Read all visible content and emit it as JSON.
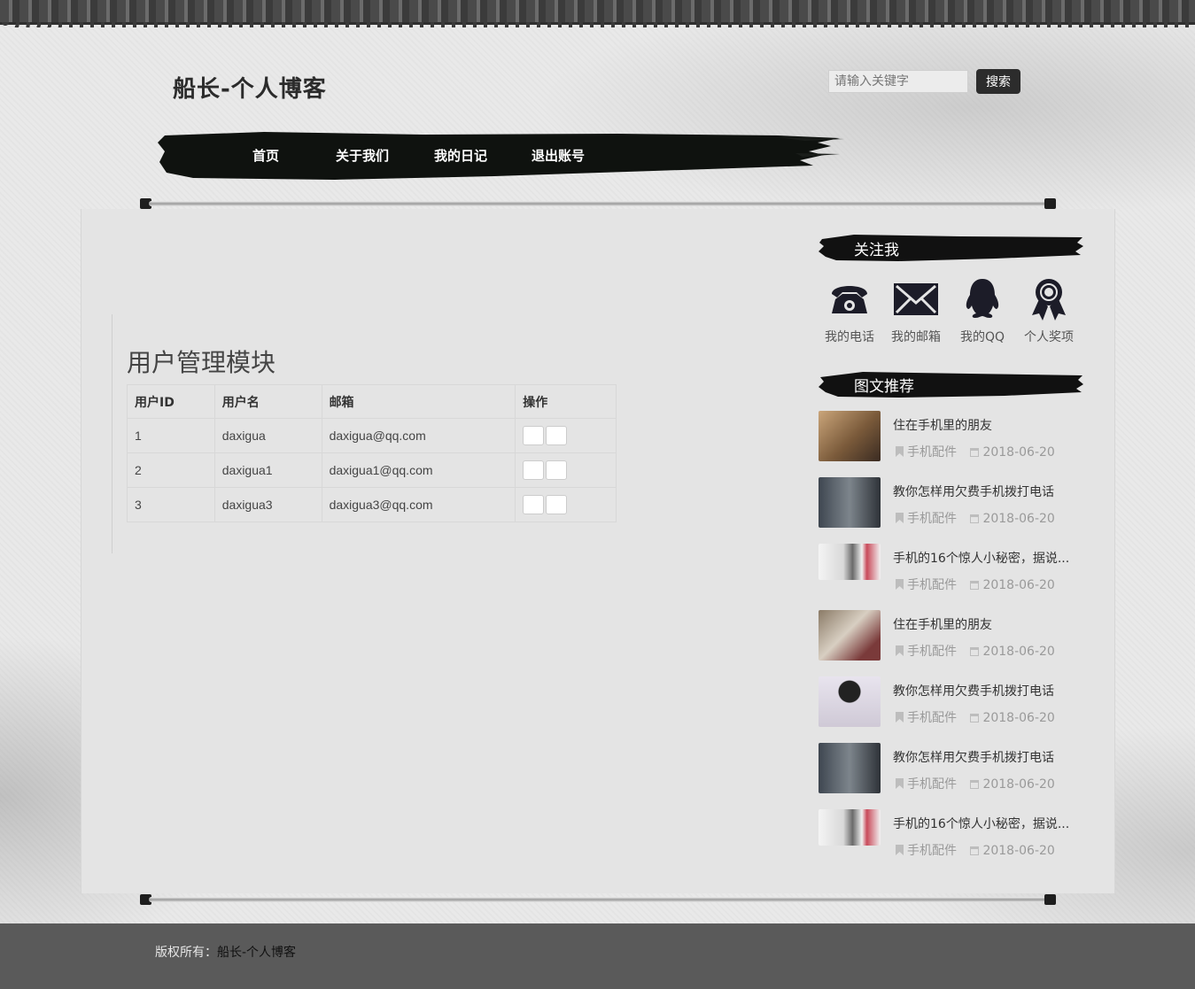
{
  "site": {
    "title": "船长-个人博客"
  },
  "search": {
    "placeholder": "请输入关键字",
    "button": "搜索"
  },
  "nav": [
    "首页",
    "关于我们",
    "我的日记",
    "退出账号"
  ],
  "main": {
    "module_title": "用户管理模块",
    "table": {
      "headers": [
        "用户ID",
        "用户名",
        "邮箱",
        "操作"
      ],
      "rows": [
        [
          "1",
          "daxigua",
          "daxigua@qq.com"
        ],
        [
          "2",
          "daxigua1",
          "daxigua1@qq.com"
        ],
        [
          "3",
          "daxigua3",
          "daxigua3@qq.com"
        ]
      ]
    }
  },
  "sidebar": {
    "follow_title": "关注我",
    "contacts": [
      {
        "label": "我的电话",
        "icon": "phone-icon"
      },
      {
        "label": "我的邮箱",
        "icon": "mail-icon"
      },
      {
        "label": "我的QQ",
        "icon": "qq-icon"
      },
      {
        "label": "个人奖项",
        "icon": "award-icon"
      }
    ],
    "recommend_title": "图文推荐",
    "articles": [
      {
        "title": "住在手机里的朋友",
        "category": "手机配件",
        "date": "2018-06-20"
      },
      {
        "title": "教你怎样用欠费手机拨打电话",
        "category": "手机配件",
        "date": "2018-06-20"
      },
      {
        "title": "手机的16个惊人小秘密，据说...",
        "category": "手机配件",
        "date": "2018-06-20"
      },
      {
        "title": "住在手机里的朋友",
        "category": "手机配件",
        "date": "2018-06-20"
      },
      {
        "title": "教你怎样用欠费手机拨打电话",
        "category": "手机配件",
        "date": "2018-06-20"
      },
      {
        "title": "教你怎样用欠费手机拨打电话",
        "category": "手机配件",
        "date": "2018-06-20"
      },
      {
        "title": "手机的16个惊人小秘密，据说...",
        "category": "手机配件",
        "date": "2018-06-20"
      }
    ]
  },
  "footer": {
    "prefix": "版权所有：",
    "name": "船长-个人博客"
  }
}
